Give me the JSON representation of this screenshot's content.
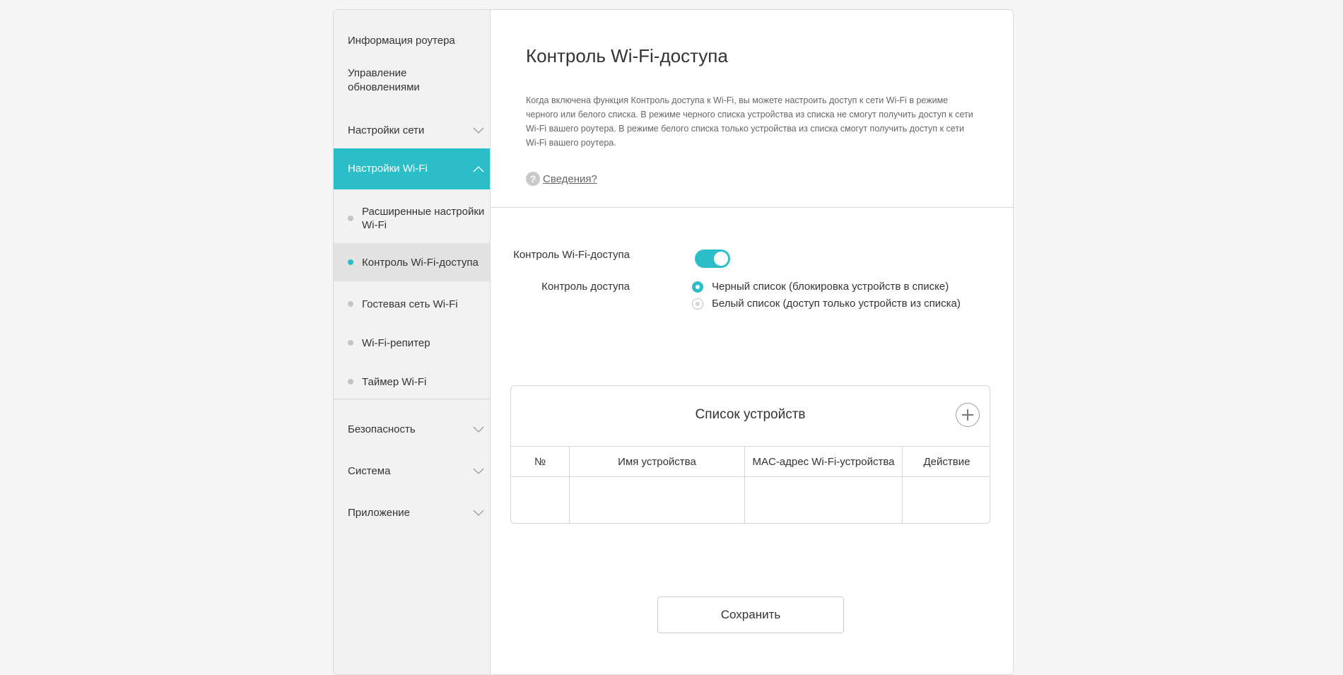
{
  "sidebar": {
    "items": [
      {
        "label": "Информация роутера"
      },
      {
        "label": "Управление обновлениями"
      },
      {
        "label": "Настройки сети"
      },
      {
        "label": "Настройки Wi-Fi"
      },
      {
        "label": "Безопасность"
      },
      {
        "label": "Система"
      },
      {
        "label": "Приложение"
      }
    ],
    "wifi_subitems": [
      {
        "label": "Расширенные настройки Wi-Fi"
      },
      {
        "label": "Контроль Wi-Fi-доступа"
      },
      {
        "label": "Гостевая сеть Wi-Fi"
      },
      {
        "label": "Wi-Fi-репитер"
      },
      {
        "label": "Таймер Wi-Fi"
      }
    ]
  },
  "main": {
    "title": "Контроль Wi-Fi-доступа",
    "description": "Когда включена функция Контроль доступа к Wi-Fi, вы можете настроить доступ к сети Wi-Fi в режиме черного или белого списка. В режиме черного списка устройства из списка не смогут получить доступ к сети Wi-Fi вашего роутера. В режиме белого списка только устройства из списка смогут получить доступ к сети Wi-Fi вашего роутера.",
    "info_icon": "?",
    "info_link": "Сведения?",
    "toggle_label": "Контроль Wi-Fi-доступа",
    "toggle_on": true,
    "access_label": "Контроль доступа",
    "radio_blacklist": "Черный список (блокировка устройств в списке)",
    "radio_whitelist": "Белый список (доступ только устройств из списка)",
    "selected_mode": "blacklist"
  },
  "device_list": {
    "title": "Список устройств",
    "columns": [
      "№",
      "Имя устройства",
      "MAC-адрес Wi-Fi-устройства",
      "Действие"
    ],
    "rows": []
  },
  "save_label": "Сохранить",
  "colors": {
    "accent": "#2bbec8"
  }
}
